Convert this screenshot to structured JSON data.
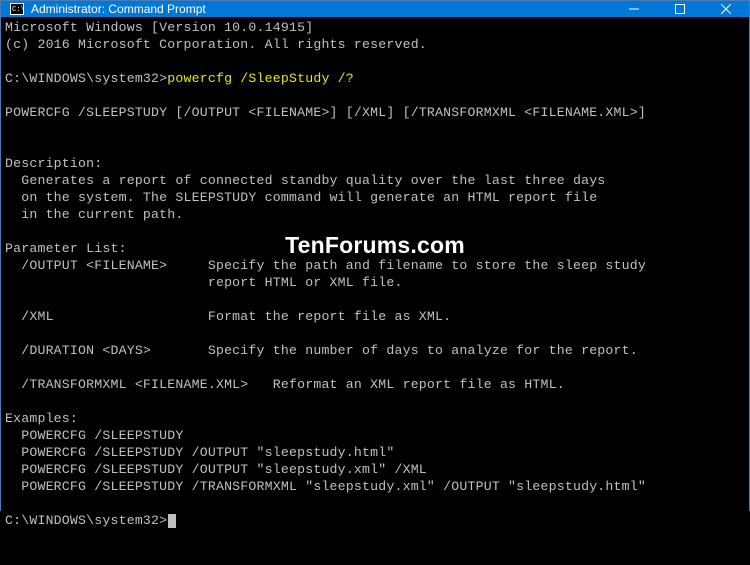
{
  "titlebar": {
    "title": "Administrator: Command Prompt"
  },
  "terminal": {
    "header_line1": "Microsoft Windows [Version 10.0.14915]",
    "header_line2": "(c) 2016 Microsoft Corporation. All rights reserved.",
    "prompt1_path": "C:\\WINDOWS\\system32>",
    "prompt1_cmd": "powercfg /SleepStudy /?",
    "usage": "POWERCFG /SLEEPSTUDY [/OUTPUT <FILENAME>] [/XML] [/TRANSFORMXML <FILENAME.XML>]",
    "desc_heading": "Description:",
    "desc_line1": "  Generates a report of connected standby quality over the last three days",
    "desc_line2": "  on the system. The SLEEPSTUDY command will generate an HTML report file",
    "desc_line3": "  in the current path.",
    "param_heading": "Parameter List:",
    "param_output1": "  /OUTPUT <FILENAME>     Specify the path and filename to store the sleep study",
    "param_output2": "                         report HTML or XML file.",
    "param_xml": "  /XML                   Format the report file as XML.",
    "param_duration": "  /DURATION <DAYS>       Specify the number of days to analyze for the report.",
    "param_transform": "  /TRANSFORMXML <FILENAME.XML>   Reformat an XML report file as HTML.",
    "ex_heading": "Examples:",
    "ex1": "  POWERCFG /SLEEPSTUDY",
    "ex2": "  POWERCFG /SLEEPSTUDY /OUTPUT \"sleepstudy.html\"",
    "ex3": "  POWERCFG /SLEEPSTUDY /OUTPUT \"sleepstudy.xml\" /XML",
    "ex4": "  POWERCFG /SLEEPSTUDY /TRANSFORMXML \"sleepstudy.xml\" /OUTPUT \"sleepstudy.html\"",
    "prompt2_path": "C:\\WINDOWS\\system32>"
  },
  "watermark": "TenForums.com"
}
